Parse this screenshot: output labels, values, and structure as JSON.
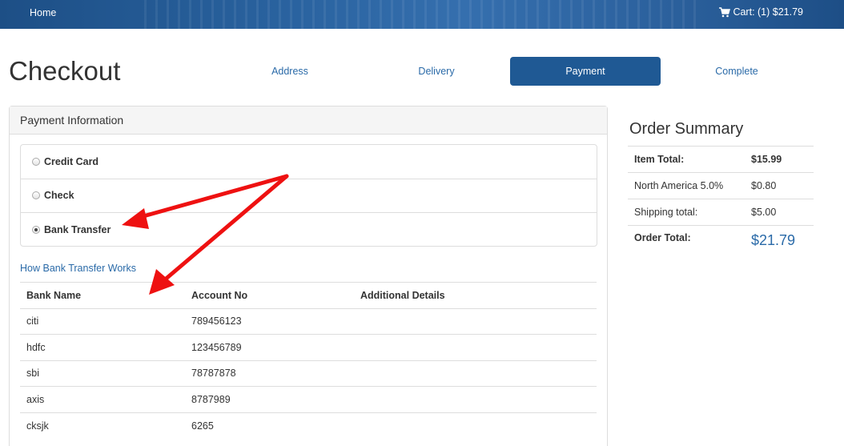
{
  "topbar": {
    "home_label": "Home",
    "cart_label": "Cart: (1) $21.79",
    "cart_icon": "cart-icon"
  },
  "page_title": "Checkout",
  "steps": [
    {
      "label": "Address",
      "active": false
    },
    {
      "label": "Delivery",
      "active": false
    },
    {
      "label": "Payment",
      "active": true
    },
    {
      "label": "Complete",
      "active": false
    }
  ],
  "payment": {
    "heading": "Payment Information",
    "options": [
      {
        "label": "Credit Card",
        "selected": false
      },
      {
        "label": "Check",
        "selected": false
      },
      {
        "label": "Bank Transfer",
        "selected": true
      }
    ],
    "how_link": "How Bank Transfer Works",
    "table": {
      "headers": [
        "Bank Name",
        "Account No",
        "Additional Details"
      ],
      "rows": [
        [
          "citi",
          "789456123",
          ""
        ],
        [
          "hdfc",
          "123456789",
          ""
        ],
        [
          "sbi",
          "78787878",
          ""
        ],
        [
          "axis",
          "8787989",
          ""
        ],
        [
          "cksjk",
          "6265",
          ""
        ]
      ]
    }
  },
  "summary": {
    "title": "Order Summary",
    "item_total_label": "Item Total:",
    "item_total_value": "$15.99",
    "tax_label": "North America 5.0%",
    "tax_value": "$0.80",
    "shipping_label": "Shipping total:",
    "shipping_value": "$5.00",
    "order_total_label": "Order Total:",
    "order_total_value": "$21.79"
  },
  "colors": {
    "accent": "#1f5994",
    "link": "#2a6aa8",
    "annotation_arrow": "#ee1111"
  }
}
